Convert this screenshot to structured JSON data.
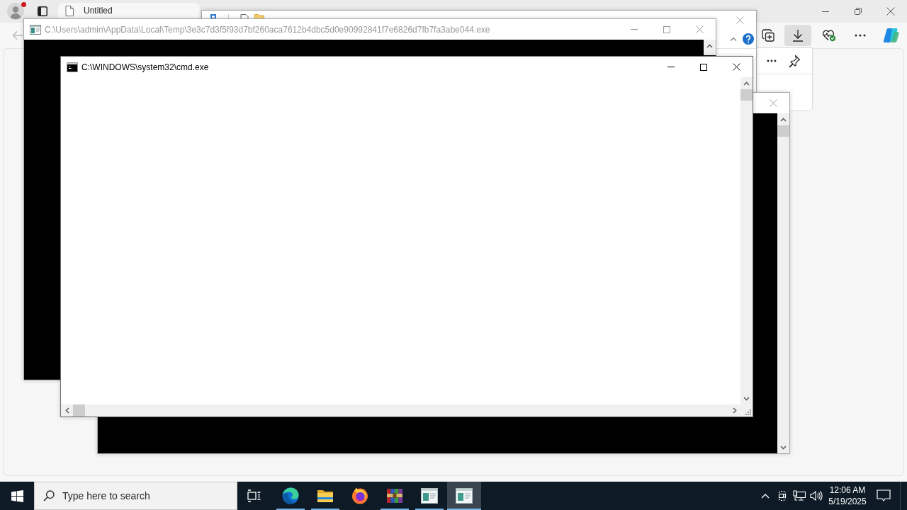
{
  "browser": {
    "profile": {
      "notification": true
    },
    "tabs": [
      {
        "title": "Untitled",
        "selected": true
      }
    ],
    "back_button": {
      "disabled": true
    },
    "toolbar": [
      {
        "kind": "collections",
        "selected": false
      },
      {
        "kind": "downloads",
        "selected": true
      },
      {
        "kind": "health",
        "selected": false
      },
      {
        "kind": "more",
        "selected": false
      },
      {
        "kind": "copilot",
        "selected": false
      }
    ],
    "downloads_panel": {
      "open": true
    }
  },
  "windows": [
    {
      "kind": "explorer",
      "active": false
    },
    {
      "kind": "console",
      "title": "C:\\Users\\admin\\AppData\\Local\\Temp\\3e3c7d3f5f93d7bf260aca7612b4dbc5d0e90992841f7e6826d7fb7fa3abe044.exe",
      "active": false
    },
    {
      "kind": "console",
      "active": false
    },
    {
      "kind": "blank",
      "title": "C:\\WINDOWS\\system32\\cmd.exe",
      "active": true
    }
  ],
  "taskbar": {
    "search": {
      "placeholder": "Type here to search"
    },
    "apps": [
      {
        "kind": "edge",
        "running": true,
        "selected": false
      },
      {
        "kind": "explorer",
        "running": true,
        "selected": false
      },
      {
        "kind": "firefox",
        "running": false,
        "selected": false
      },
      {
        "kind": "winrar",
        "running": true,
        "selected": false
      },
      {
        "kind": "app",
        "running": true,
        "selected": false
      },
      {
        "kind": "app",
        "running": true,
        "selected": true
      }
    ],
    "clock": {
      "time": "12:06 AM",
      "date": "5/19/2025"
    }
  }
}
